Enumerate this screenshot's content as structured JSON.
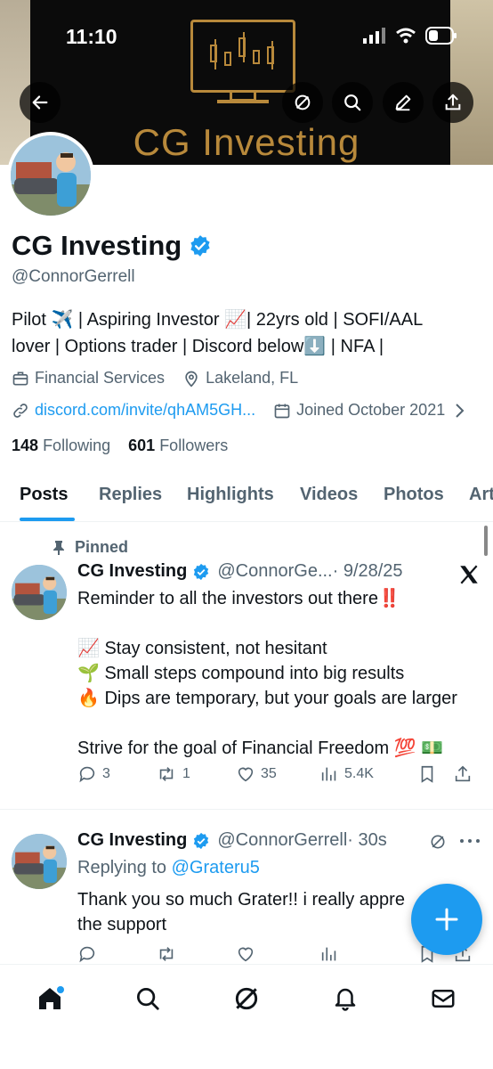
{
  "status": {
    "time": "11:10"
  },
  "banner": {
    "title": "CG Investing"
  },
  "profile": {
    "name": "CG Investing",
    "handle": "@ConnorGerrell",
    "bio_line1": "Pilot ✈️ | Aspiring Investor 📈| 22yrs old | SOFI/AAL",
    "bio_line2": "lover | Options trader | Discord below⬇️ | NFA |",
    "category": "Financial Services",
    "location": "Lakeland, FL",
    "link": "discord.com/invite/qhAM5GH...",
    "joined": "Joined October 2021",
    "following_count": "148",
    "following_label": "Following",
    "followers_count": "601",
    "followers_label": "Followers"
  },
  "tabs": [
    {
      "label": "Posts",
      "active": true
    },
    {
      "label": "Replies"
    },
    {
      "label": "Highlights"
    },
    {
      "label": "Videos"
    },
    {
      "label": "Photos"
    },
    {
      "label": "Art"
    }
  ],
  "posts": [
    {
      "pinned_label": "Pinned",
      "author": "CG Investing",
      "handle": "@ConnorGe...",
      "date": "· 9/28/25",
      "lines": [
        "Reminder to all the investors out there‼️",
        "",
        "📈 Stay consistent, not hesitant",
        "🌱 Small steps compound into big results",
        "🔥 Dips are temporary, but your goals are larger",
        "",
        "Strive for the goal of Financial Freedom 💯 💵"
      ],
      "replies": "3",
      "reposts": "1",
      "likes": "35",
      "views": "5.4K"
    },
    {
      "author": "CG Investing",
      "handle": "@ConnorGerrell",
      "date": "· 30s",
      "replying_prefix": "Replying to",
      "replying_to": "@Grateru5",
      "line1": "Thank you so much Grater!! i really appre",
      "line2": "the support"
    }
  ],
  "colors": {
    "accent": "#1d9bf0",
    "text": "#0f1419",
    "secondary": "#536471",
    "banner_gold": "#b8893b"
  }
}
